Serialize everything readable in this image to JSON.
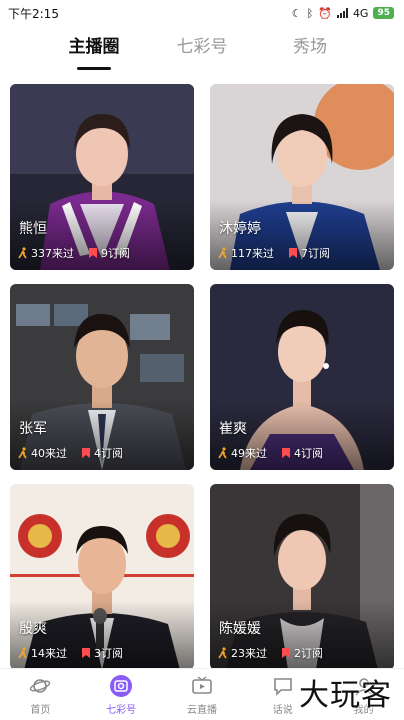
{
  "status_bar": {
    "time": "下午2:15",
    "network": "4G",
    "battery": "95"
  },
  "tabs": [
    {
      "label": "主播圈",
      "active": true
    },
    {
      "label": "七彩号",
      "active": false
    },
    {
      "label": "秀场",
      "active": false
    }
  ],
  "cards": [
    {
      "name": "熊恒",
      "visits": "337来过",
      "subs": "9订阅"
    },
    {
      "name": "沐婷婷",
      "visits": "117来过",
      "subs": "7订阅"
    },
    {
      "name": "张军",
      "visits": "40来过",
      "subs": "4订阅"
    },
    {
      "name": "崔爽",
      "visits": "49来过",
      "subs": "4订阅"
    },
    {
      "name": "殷爽",
      "visits": "14来过",
      "subs": "3订阅"
    },
    {
      "name": "陈媛媛",
      "visits": "23来过",
      "subs": "2订阅"
    }
  ],
  "bottom_nav": [
    {
      "label": "首页",
      "icon": "planet-icon"
    },
    {
      "label": "七彩号",
      "icon": "camera-icon",
      "active": true
    },
    {
      "label": "云直播",
      "icon": "tv-play-icon"
    },
    {
      "label": "话说",
      "icon": "chat-icon"
    },
    {
      "label": "我的",
      "icon": "user-icon"
    }
  ],
  "watermark": "大玩客",
  "colors": {
    "accent": "#8a5cf6",
    "walk_icon": "#f5a623",
    "sub_icon": "#ff4d4f"
  }
}
